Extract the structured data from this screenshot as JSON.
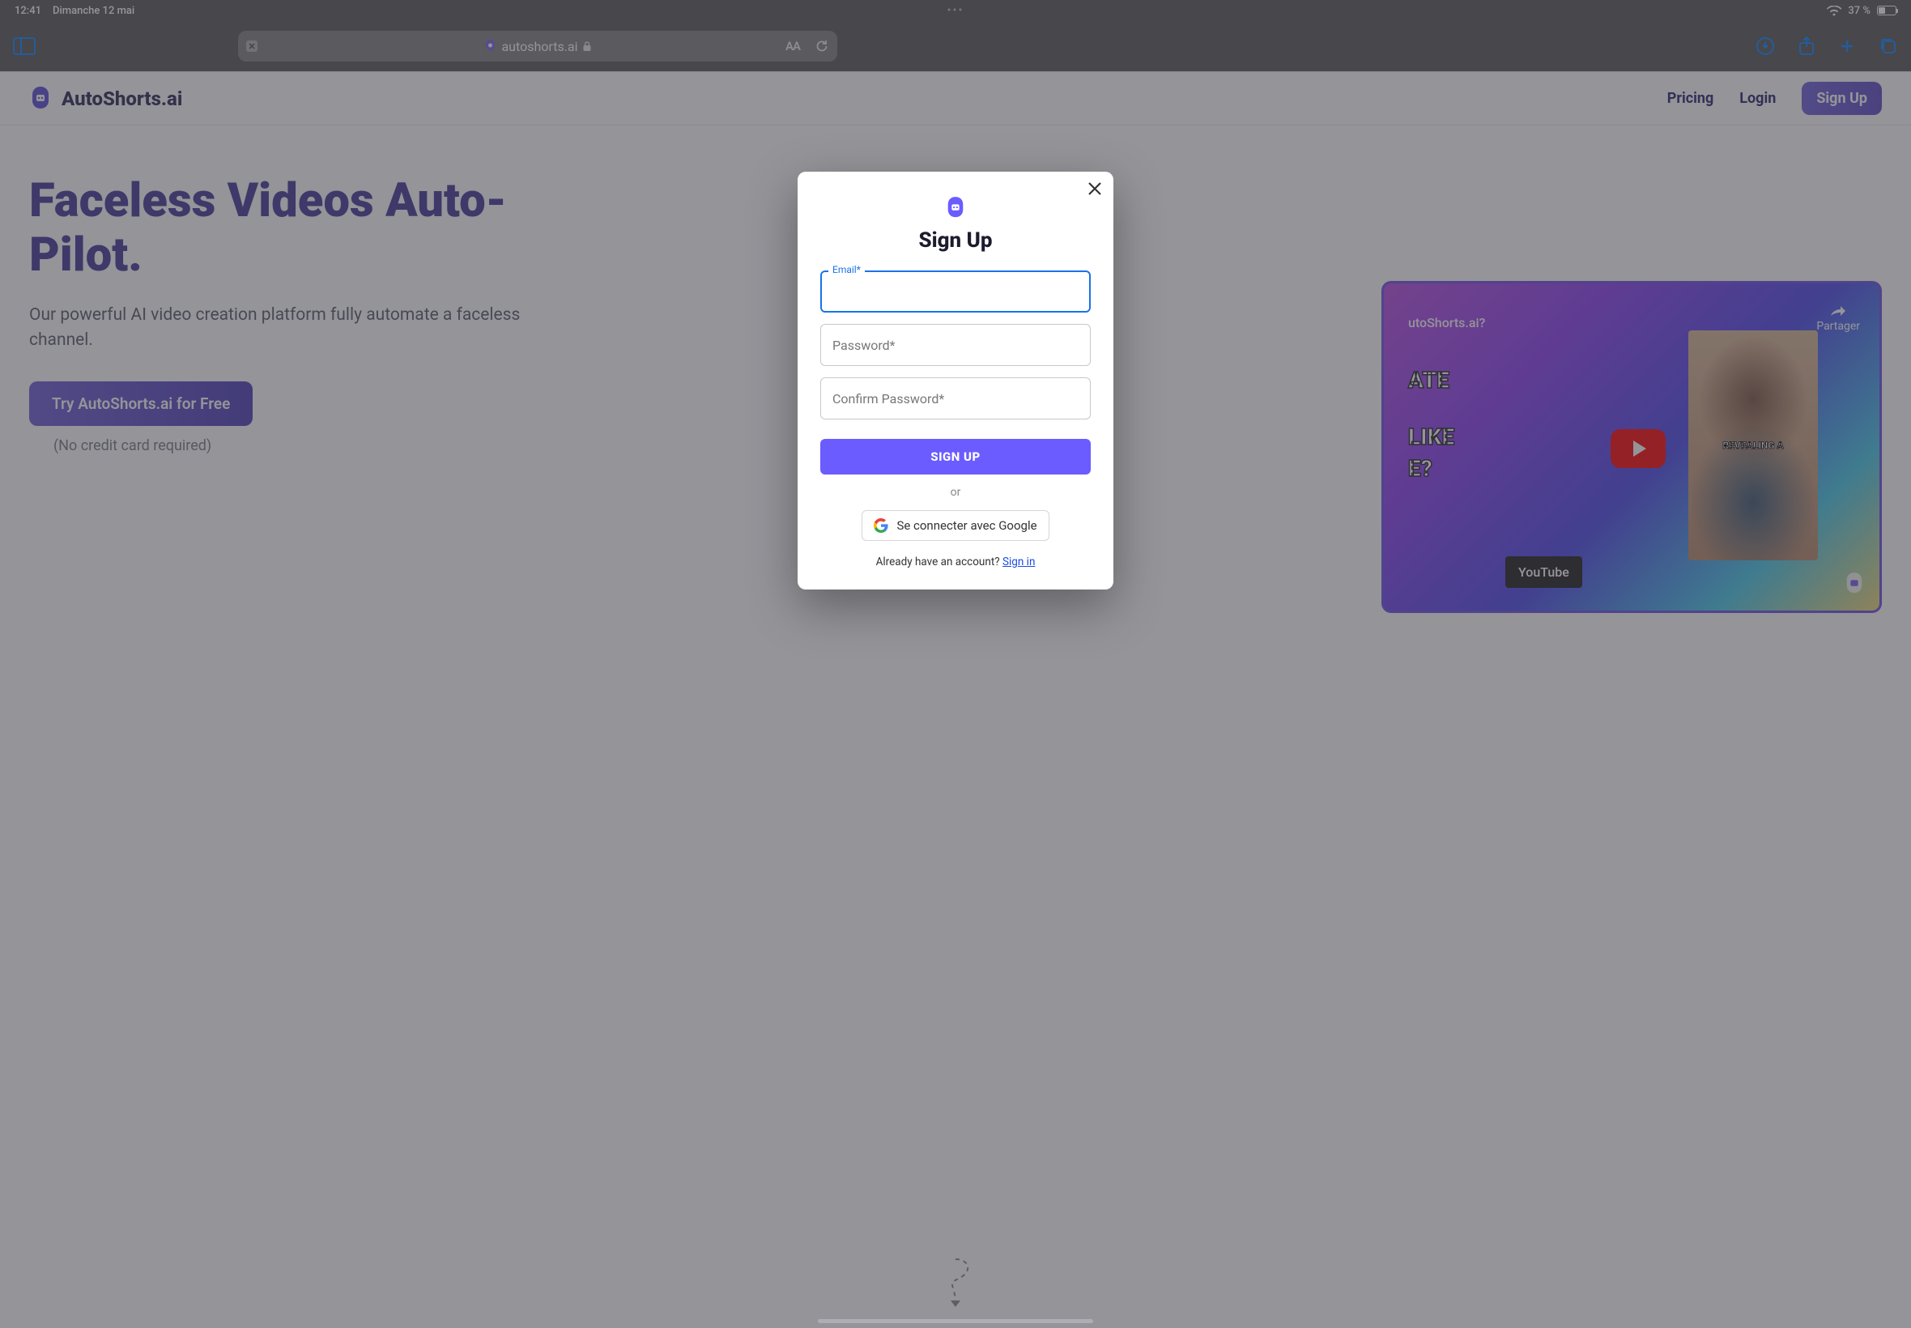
{
  "status": {
    "time": "12:41",
    "date": "Dimanche 12 mai",
    "dots": "•••",
    "battery_pct": "37 %"
  },
  "browser": {
    "url_display": "autoshorts.ai",
    "aa": "AA"
  },
  "page": {
    "brand": "AutoShorts.ai",
    "nav": {
      "pricing": "Pricing",
      "login": "Login",
      "signup": "Sign Up"
    },
    "hero": {
      "title_line": "Faceless Videos Auto-Pilot.",
      "sub": "Our powerful AI video creation platform fully automate a faceless channel.",
      "cta": "Try AutoShorts.ai for Free",
      "cta_note": "(No credit card required)"
    },
    "video": {
      "question": "utoShorts.ai?",
      "line1": "ATE",
      "line2": "LIKE",
      "line3": "E?",
      "share": "Partager",
      "watch": "YouTube",
      "thumb_text": "REVEALING A"
    }
  },
  "modal": {
    "title": "Sign Up",
    "email_label": "Email*",
    "password_placeholder": "Password*",
    "confirm_placeholder": "Confirm Password*",
    "submit": "SIGN UP",
    "or": "or",
    "google": "Se connecter avec Google",
    "already_text": "Already have an account? ",
    "signin": "Sign in"
  }
}
